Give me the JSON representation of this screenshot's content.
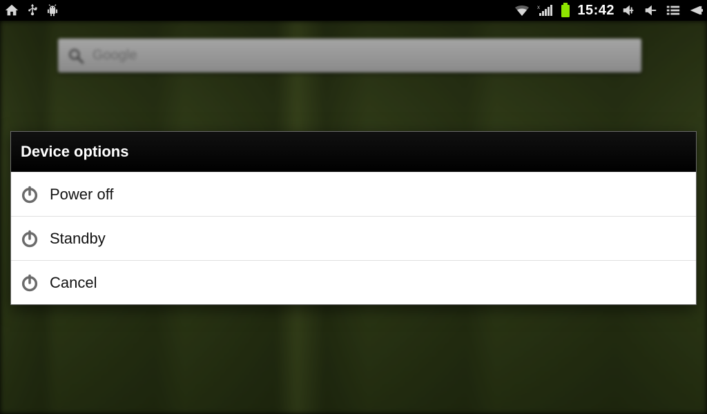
{
  "status_bar": {
    "icons_left": [
      "home-icon",
      "usb-icon",
      "android-debug-icon"
    ],
    "wifi_strength": 3,
    "cell_bars": 5,
    "battery_level": 100,
    "battery_color": "#8FE600",
    "clock": "15:42",
    "icons_right_after_clock": [
      "volume-up-icon",
      "volume-down-icon",
      "menu-icon",
      "back-icon"
    ]
  },
  "search_widget": {
    "placeholder": "Google"
  },
  "dialog": {
    "title": "Device options",
    "items": [
      {
        "icon": "power-icon",
        "label": "Power off"
      },
      {
        "icon": "power-icon",
        "label": "Standby"
      },
      {
        "icon": "power-icon",
        "label": "Cancel"
      }
    ]
  }
}
